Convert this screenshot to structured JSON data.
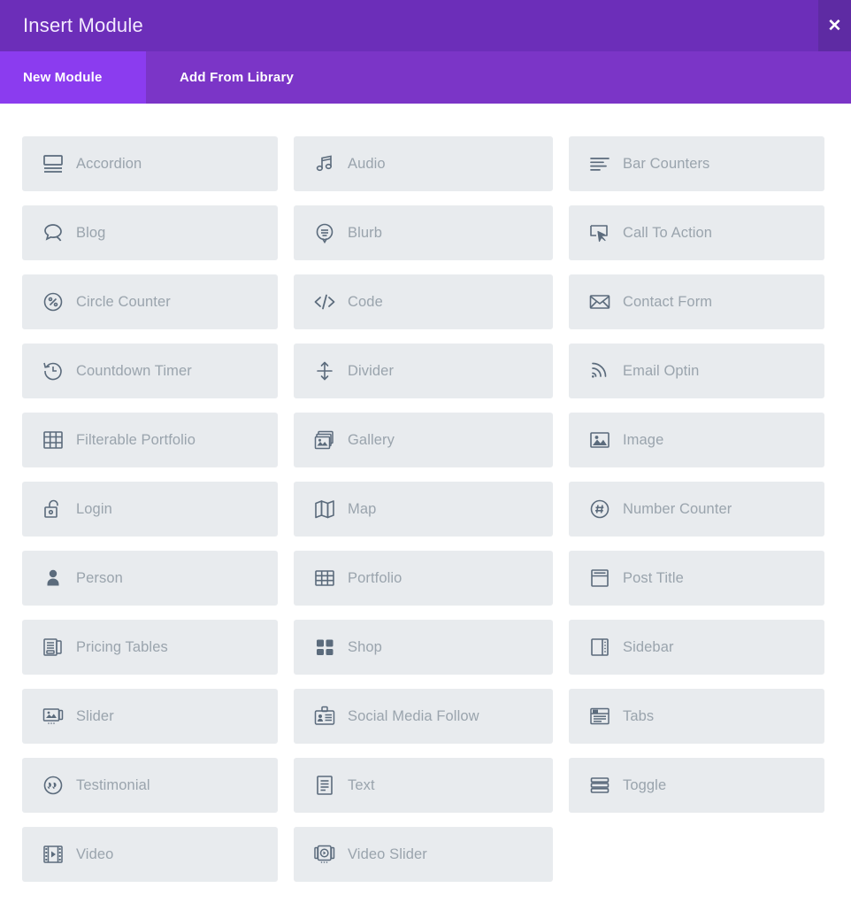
{
  "header": {
    "title": "Insert Module",
    "close_label": "✕",
    "close_icon": "close-icon",
    "bg_color": "#6c2eb9",
    "close_bg_color": "#5e2ba3"
  },
  "tabs": [
    {
      "label": "New Module",
      "active": true,
      "bg_color": "#8b3cef"
    },
    {
      "label": "Add From Library",
      "active": false,
      "bg_color": "#7b35c7"
    }
  ],
  "card_style": {
    "bg_color": "#e8ebee",
    "label_color": "#9aa4ad",
    "icon_color": "#5b6b7c"
  },
  "columns": [
    {
      "modules": [
        {
          "label": "Accordion",
          "icon": "accordion-icon"
        },
        {
          "label": "Blog",
          "icon": "speech-bubbles-icon"
        },
        {
          "label": "Circle Counter",
          "icon": "circle-percent-icon"
        },
        {
          "label": "Countdown Timer",
          "icon": "clock-rewind-icon"
        },
        {
          "label": "Filterable Portfolio",
          "icon": "grid-table-icon"
        },
        {
          "label": "Login",
          "icon": "unlocked-padlock-icon"
        },
        {
          "label": "Person",
          "icon": "person-icon"
        },
        {
          "label": "Pricing Tables",
          "icon": "pricing-tables-icon"
        },
        {
          "label": "Slider",
          "icon": "image-slider-icon"
        },
        {
          "label": "Testimonial",
          "icon": "quote-circle-icon"
        },
        {
          "label": "Video",
          "icon": "film-play-icon"
        }
      ]
    },
    {
      "modules": [
        {
          "label": "Audio",
          "icon": "music-note-icon"
        },
        {
          "label": "Blurb",
          "icon": "blurb-bubble-icon"
        },
        {
          "label": "Code",
          "icon": "code-brackets-icon"
        },
        {
          "label": "Divider",
          "icon": "vertical-arrows-icon"
        },
        {
          "label": "Gallery",
          "icon": "stacked-images-icon"
        },
        {
          "label": "Map",
          "icon": "folded-map-icon"
        },
        {
          "label": "Portfolio",
          "icon": "grid-table-icon"
        },
        {
          "label": "Shop",
          "icon": "four-squares-icon"
        },
        {
          "label": "Social Media Follow",
          "icon": "id-badge-icon"
        },
        {
          "label": "Text",
          "icon": "text-document-icon"
        },
        {
          "label": "Video Slider",
          "icon": "video-slider-icon"
        }
      ]
    },
    {
      "modules": [
        {
          "label": "Bar Counters",
          "icon": "bar-counters-icon"
        },
        {
          "label": "Call To Action",
          "icon": "cursor-click-icon"
        },
        {
          "label": "Contact Form",
          "icon": "envelope-icon"
        },
        {
          "label": "Email Optin",
          "icon": "rss-signal-icon"
        },
        {
          "label": "Image",
          "icon": "picture-icon"
        },
        {
          "label": "Number Counter",
          "icon": "hash-circle-icon"
        },
        {
          "label": "Post Title",
          "icon": "post-title-icon"
        },
        {
          "label": "Sidebar",
          "icon": "sidebar-layout-icon"
        },
        {
          "label": "Tabs",
          "icon": "tabs-icon"
        },
        {
          "label": "Toggle",
          "icon": "toggle-bars-icon"
        }
      ]
    }
  ]
}
